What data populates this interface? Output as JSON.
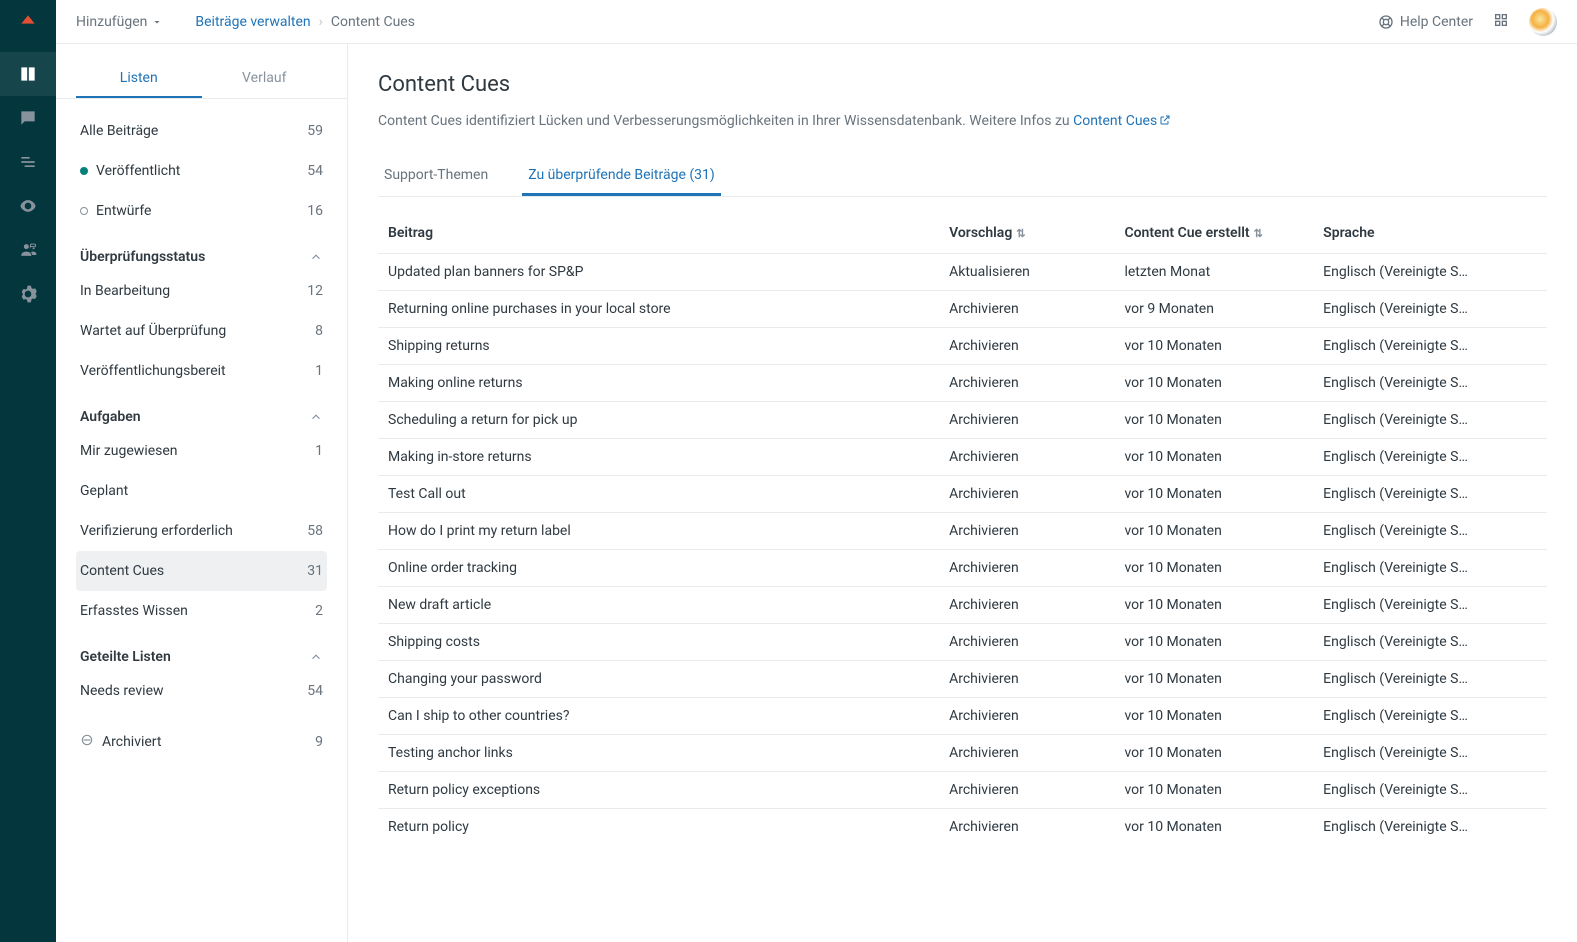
{
  "topbar": {
    "add_label": "Hinzufügen",
    "breadcrumb_link": "Beiträge verwalten",
    "breadcrumb_current": "Content Cues",
    "help_center": "Help Center"
  },
  "sidebar": {
    "tab_listen": "Listen",
    "tab_verlauf": "Verlauf",
    "all_posts": {
      "label": "Alle Beiträge",
      "count": "59"
    },
    "published": {
      "label": "Veröffentlicht",
      "count": "54"
    },
    "drafts": {
      "label": "Entwürfe",
      "count": "16"
    },
    "review_header": "Überprüfungsstatus",
    "review": [
      {
        "label": "In Bearbeitung",
        "count": "12"
      },
      {
        "label": "Wartet auf Überprüfung",
        "count": "8"
      },
      {
        "label": "Veröffentlichungsbereit",
        "count": "1"
      }
    ],
    "tasks_header": "Aufgaben",
    "tasks": [
      {
        "label": "Mir zugewiesen",
        "count": "1"
      },
      {
        "label": "Geplant",
        "count": ""
      },
      {
        "label": "Verifizierung erforderlich",
        "count": "58"
      },
      {
        "label": "Content Cues",
        "count": "31"
      },
      {
        "label": "Erfasstes Wissen",
        "count": "2"
      }
    ],
    "shared_header": "Geteilte Listen",
    "shared": [
      {
        "label": "Needs review",
        "count": "54"
      }
    ],
    "archived": {
      "label": "Archiviert",
      "count": "9"
    }
  },
  "content": {
    "title": "Content Cues",
    "desc_text": "Content Cues identifiziert Lücken und Verbesserungsmöglichkeiten in Ihrer Wissensdatenbank. Weitere Infos zu ",
    "desc_link": "Content Cues",
    "tab_support": "Support-Themen",
    "tab_review": "Zu überprüfende Beiträge (31)",
    "cols": {
      "beitrag": "Beitrag",
      "vorschlag": "Vorschlag",
      "erstellt": "Content Cue erstellt",
      "sprache": "Sprache"
    },
    "rows": [
      {
        "beitrag": "Updated plan banners for SP&P",
        "vorschlag": "Aktualisieren",
        "erstellt": "letzten Monat",
        "sprache": "Englisch (Vereinigte S…"
      },
      {
        "beitrag": "Returning online purchases in your local store",
        "vorschlag": "Archivieren",
        "erstellt": "vor 9 Monaten",
        "sprache": "Englisch (Vereinigte S…"
      },
      {
        "beitrag": "Shipping returns",
        "vorschlag": "Archivieren",
        "erstellt": "vor 10 Monaten",
        "sprache": "Englisch (Vereinigte S…"
      },
      {
        "beitrag": "Making online returns",
        "vorschlag": "Archivieren",
        "erstellt": "vor 10 Monaten",
        "sprache": "Englisch (Vereinigte S…"
      },
      {
        "beitrag": "Scheduling a return for pick up",
        "vorschlag": "Archivieren",
        "erstellt": "vor 10 Monaten",
        "sprache": "Englisch (Vereinigte S…"
      },
      {
        "beitrag": "Making in-store returns",
        "vorschlag": "Archivieren",
        "erstellt": "vor 10 Monaten",
        "sprache": "Englisch (Vereinigte S…"
      },
      {
        "beitrag": "Test Call out",
        "vorschlag": "Archivieren",
        "erstellt": "vor 10 Monaten",
        "sprache": "Englisch (Vereinigte S…"
      },
      {
        "beitrag": "How do I print my return label",
        "vorschlag": "Archivieren",
        "erstellt": "vor 10 Monaten",
        "sprache": "Englisch (Vereinigte S…"
      },
      {
        "beitrag": "Online order tracking",
        "vorschlag": "Archivieren",
        "erstellt": "vor 10 Monaten",
        "sprache": "Englisch (Vereinigte S…"
      },
      {
        "beitrag": "New draft article",
        "vorschlag": "Archivieren",
        "erstellt": "vor 10 Monaten",
        "sprache": "Englisch (Vereinigte S…"
      },
      {
        "beitrag": "Shipping costs",
        "vorschlag": "Archivieren",
        "erstellt": "vor 10 Monaten",
        "sprache": "Englisch (Vereinigte S…"
      },
      {
        "beitrag": "Changing your password",
        "vorschlag": "Archivieren",
        "erstellt": "vor 10 Monaten",
        "sprache": "Englisch (Vereinigte S…"
      },
      {
        "beitrag": "Can I ship to other countries?",
        "vorschlag": "Archivieren",
        "erstellt": "vor 10 Monaten",
        "sprache": "Englisch (Vereinigte S…"
      },
      {
        "beitrag": "Testing anchor links",
        "vorschlag": "Archivieren",
        "erstellt": "vor 10 Monaten",
        "sprache": "Englisch (Vereinigte S…"
      },
      {
        "beitrag": "Return policy exceptions",
        "vorschlag": "Archivieren",
        "erstellt": "vor 10 Monaten",
        "sprache": "Englisch (Vereinigte S…"
      },
      {
        "beitrag": "Return policy",
        "vorschlag": "Archivieren",
        "erstellt": "vor 10 Monaten",
        "sprache": "Englisch (Vereinigte S…"
      }
    ]
  }
}
